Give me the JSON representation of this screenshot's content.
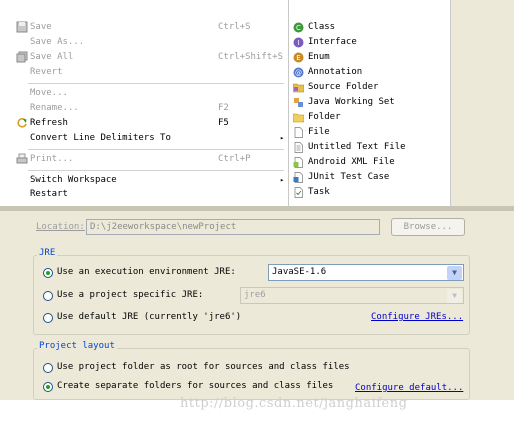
{
  "file_menu": {
    "save": {
      "label": "Save",
      "shortcut": "Ctrl+S",
      "icon": "save-icon"
    },
    "save_as": {
      "label": "Save As..."
    },
    "save_all": {
      "label": "Save All",
      "shortcut": "Ctrl+Shift+S",
      "icon": "save-all-icon"
    },
    "revert": {
      "label": "Revert"
    },
    "move": {
      "label": "Move..."
    },
    "rename": {
      "label": "Rename...",
      "shortcut": "F2"
    },
    "refresh": {
      "label": "Refresh",
      "shortcut": "F5",
      "icon": "refresh-icon"
    },
    "convert": {
      "label": "Convert Line Delimiters To"
    },
    "print": {
      "label": "Print...",
      "shortcut": "Ctrl+P",
      "icon": "print-icon"
    },
    "switch_workspace": {
      "label": "Switch Workspace"
    },
    "restart": {
      "label": "Restart"
    },
    "submenu_arrow": "▸"
  },
  "new_submenu": {
    "items": [
      {
        "label": "Class",
        "icon": "class-icon"
      },
      {
        "label": "Interface",
        "icon": "interface-icon"
      },
      {
        "label": "Enum",
        "icon": "enum-icon"
      },
      {
        "label": "Annotation",
        "icon": "annotation-icon"
      },
      {
        "label": "Source Folder",
        "icon": "source-folder-icon"
      },
      {
        "label": "Java Working Set",
        "icon": "working-set-icon"
      },
      {
        "label": "Folder",
        "icon": "folder-icon"
      },
      {
        "label": "File",
        "icon": "file-icon"
      },
      {
        "label": "Untitled Text File",
        "icon": "text-file-icon"
      },
      {
        "label": "Android XML File",
        "icon": "android-xml-icon"
      },
      {
        "label": "JUnit Test Case",
        "icon": "junit-icon"
      },
      {
        "label": "Task",
        "icon": "task-icon"
      }
    ]
  },
  "dialog": {
    "location_label": "Location:",
    "location_value": "D:\\j2eeworkspace\\newProject",
    "browse_label": "Browse...",
    "jre_group": {
      "title": "JRE",
      "use_env_label": "Use an execution environment JRE:",
      "use_env_value": "JavaSE-1.6",
      "use_specific_label": "Use a project specific JRE:",
      "use_specific_value": "jre6",
      "use_default_label": "Use default JRE (currently 'jre6')",
      "configure_link": "Configure JREs..."
    },
    "layout_group": {
      "title": "Project layout",
      "root_label": "Use project folder as root for sources and class files",
      "separate_label": "Create separate folders for sources and class files",
      "configure_link": "Configure default..."
    }
  },
  "watermark": "http://blog.csdn.net/janghaifeng",
  "colors": {
    "accent_blue": "#0046d5",
    "link_blue": "#0000cc",
    "dialog_bg": "#ece9d8",
    "disabled_text": "#9c9c9c"
  }
}
